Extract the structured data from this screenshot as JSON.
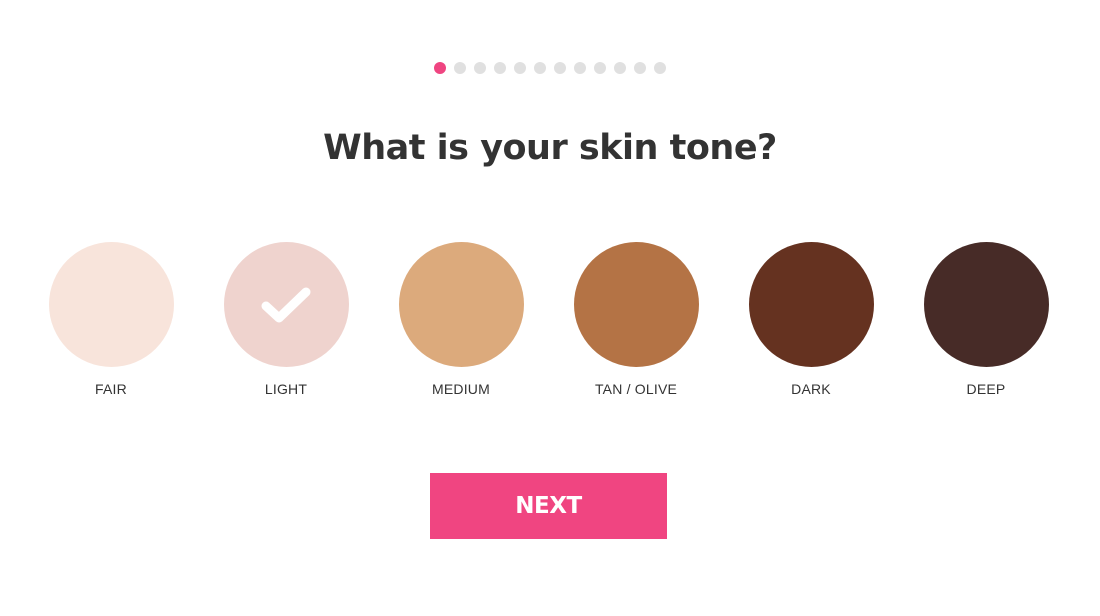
{
  "progress": {
    "total_steps": 12,
    "current_step": 1,
    "active_color": "#ef4581",
    "inactive_color": "#e0e0e0"
  },
  "question": "What is your skin tone?",
  "tones": [
    {
      "label": "FAIR",
      "color": "#f8e4db",
      "selected": false
    },
    {
      "label": "LIGHT",
      "color": "#efd3ce",
      "selected": true
    },
    {
      "label": "MEDIUM",
      "color": "#dcaa7c",
      "selected": false
    },
    {
      "label": "TAN / OLIVE",
      "color": "#b47345",
      "selected": false
    },
    {
      "label": "DARK",
      "color": "#653220",
      "selected": false
    },
    {
      "label": "DEEP",
      "color": "#472b27",
      "selected": false
    }
  ],
  "selected_icon": "checkmark-icon",
  "next_button": {
    "label": "NEXT",
    "color": "#f04581"
  }
}
